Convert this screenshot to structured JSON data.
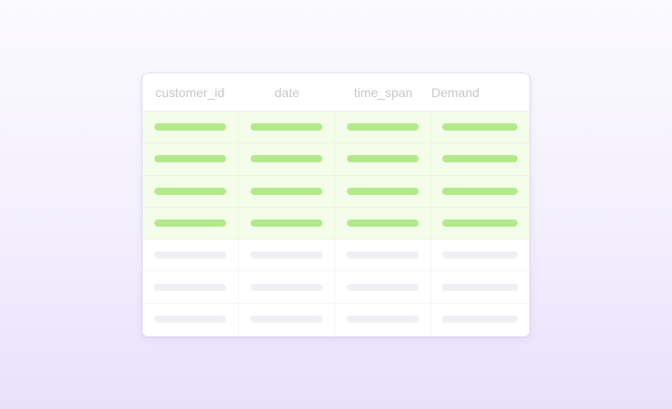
{
  "table": {
    "columns": [
      "customer_id",
      "date",
      "time_span",
      "Demand"
    ],
    "rows": [
      {
        "state": "highlighted"
      },
      {
        "state": "highlighted"
      },
      {
        "state": "highlighted"
      },
      {
        "state": "highlighted"
      },
      {
        "state": "placeholder"
      },
      {
        "state": "placeholder"
      },
      {
        "state": "placeholder"
      }
    ],
    "colors": {
      "highlight_bar": "#b3e98c",
      "highlight_row": "#f4fde9",
      "placeholder_bar": "#eff0f3",
      "header_text": "#c6c8cc"
    }
  }
}
